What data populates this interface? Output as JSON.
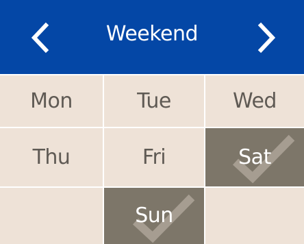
{
  "header": {
    "title": "Weekend",
    "prev_icon": "chevron-left-icon",
    "next_icon": "chevron-right-icon",
    "background_color": "#0447a6",
    "text_color": "#ffffff"
  },
  "days": {
    "mon": {
      "label": "Mon",
      "selected": false
    },
    "tue": {
      "label": "Tue",
      "selected": false
    },
    "wed": {
      "label": "Wed",
      "selected": false
    },
    "thu": {
      "label": "Thu",
      "selected": false
    },
    "fri": {
      "label": "Fri",
      "selected": false
    },
    "sat": {
      "label": "Sat",
      "selected": true
    },
    "sun": {
      "label": "Sun",
      "selected": true
    }
  },
  "colors": {
    "unselected_bg": "#eee2d7",
    "selected_bg": "#7d7669",
    "unselected_text": "#5f5a54",
    "selected_text": "#ffffff",
    "check_mark": "#a69d91"
  },
  "icons": {
    "selected_mark": "check-icon"
  }
}
